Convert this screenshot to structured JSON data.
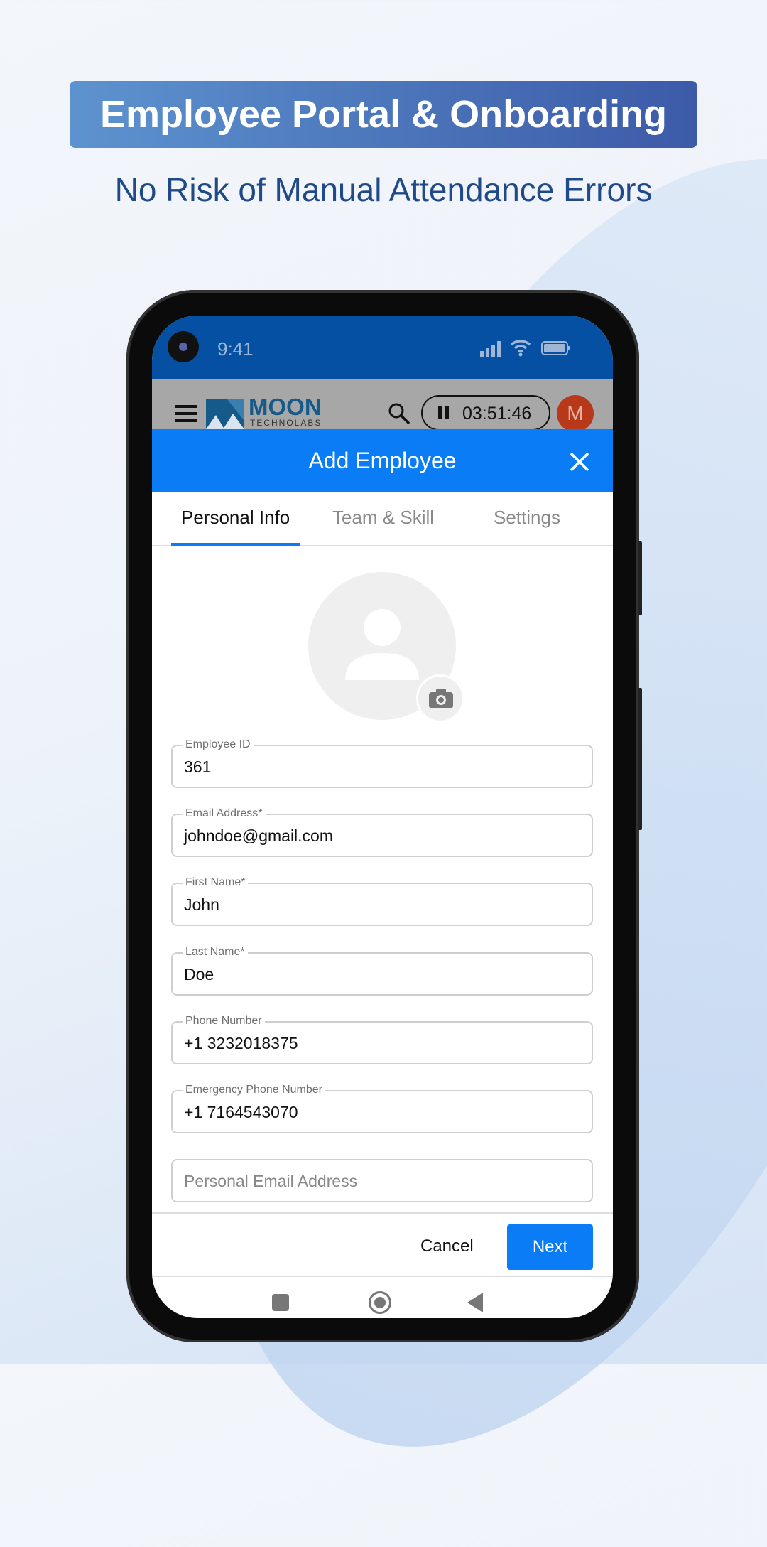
{
  "promo": {
    "title": "Employee Portal & Onboarding",
    "subtitle": "No Risk of Manual Attendance Errors"
  },
  "status_bar": {
    "time": "9:41"
  },
  "app_bar": {
    "brand": "MOON",
    "brand_sub": "TECHNOLABS",
    "timer": "03:51:46",
    "avatar_initial": "M"
  },
  "modal": {
    "title": "Add Employee",
    "tabs": [
      {
        "label": "Personal Info",
        "active": true
      },
      {
        "label": "Team & Skill"
      },
      {
        "label": "Settings"
      }
    ]
  },
  "fields": [
    {
      "label": "Employee ID",
      "value": "361"
    },
    {
      "label": "Email Address*",
      "value": "johndoe@gmail.com"
    },
    {
      "label": "First Name*",
      "value": "John"
    },
    {
      "label": "Last Name*",
      "value": "Doe"
    },
    {
      "label": "Phone Number",
      "value": "+1 3232018375"
    },
    {
      "label": "Emergency Phone Number",
      "value": "+1 7164543070"
    },
    {
      "placeholder": "Personal Email Address"
    }
  ],
  "actions": {
    "cancel": "Cancel",
    "next": "Next"
  },
  "colors": {
    "primary": "#0a7cf5",
    "status_bar": "#0550a3",
    "avatar": "#b8391a"
  }
}
